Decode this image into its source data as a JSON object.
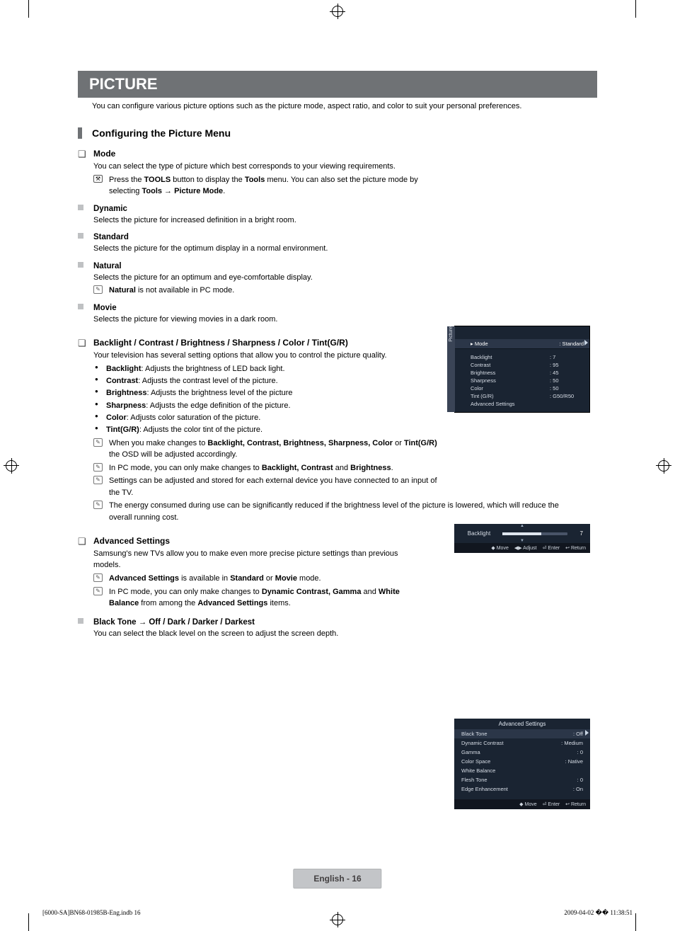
{
  "header": {
    "title": "PICTURE"
  },
  "intro": "You can configure various picture options such as the picture mode, aspect ratio, and color to suit your personal preferences.",
  "section_title": "Configuring the Picture Menu",
  "mode": {
    "title": "Mode",
    "desc": "You can select the type of picture which best corresponds to your viewing requirements.",
    "tools_pre": "Press the ",
    "tools_b1": "TOOLS",
    "tools_mid": " button to display the ",
    "tools_b2": "Tools",
    "tools_mid2": " menu. You can also set the picture mode by selecting ",
    "tools_b3": "Tools → Picture Mode",
    "tools_end": ".",
    "dynamic": {
      "title": "Dynamic",
      "desc": "Selects the picture for increased definition in a bright room."
    },
    "standard": {
      "title": "Standard",
      "desc": "Selects the picture for the optimum display in a normal environment."
    },
    "natural": {
      "title": "Natural",
      "desc": "Selects the picture for an optimum and eye-comfortable display.",
      "note_b": "Natural",
      "note_rest": " is not available in PC mode."
    },
    "movie": {
      "title": "Movie",
      "desc": "Selects the picture for viewing movies in a dark room."
    }
  },
  "settings": {
    "title": "Backlight / Contrast / Brightness / Sharpness / Color / Tint(G/R)",
    "desc": "Your television has several setting options that allow you to control the picture quality.",
    "items": {
      "backlight_b": "Backlight",
      "backlight_t": ": Adjusts the brightness of LED back light.",
      "contrast_b": "Contrast",
      "contrast_t": ": Adjusts the contrast level of the picture.",
      "brightness_b": "Brightness",
      "brightness_t": ": Adjusts the brightness level of the picture",
      "sharpness_b": "Sharpness",
      "sharpness_t": ": Adjusts the edge definition of the picture.",
      "color_b": "Color",
      "color_t": ": Adjusts color saturation of the picture.",
      "tint_b": "Tint(G/R)",
      "tint_t": ": Adjusts the color tint of the picture."
    },
    "note1_pre": "When you make changes to ",
    "note1_b1": "Backlight, Contrast, Brightness, Sharpness, Color",
    "note1_mid": " or ",
    "note1_b2": "Tint(G/R)",
    "note1_end": " the OSD will be adjusted accordingly.",
    "note2_pre": "In PC mode, you can only make changes to ",
    "note2_b": "Backlight, Contrast",
    "note2_mid": " and ",
    "note2_b2": "Brightness",
    "note2_end": ".",
    "note3": "Settings can be adjusted and stored for each external device you have connected to an input of the TV.",
    "note4": "The energy consumed during use can be significantly reduced if the brightness level of the picture is lowered, which will reduce the overall running cost."
  },
  "advanced": {
    "title": "Advanced Settings",
    "desc": "Samsung's new TVs allow you to make even more precise picture settings than previous models.",
    "note1_b": "Advanced Settings",
    "note1_mid": " is available in ",
    "note1_b2": "Standard",
    "note1_mid2": " or ",
    "note1_b3": "Movie",
    "note1_end": " mode.",
    "note2_pre": "In PC mode, you can only make changes to ",
    "note2_b": "Dynamic Contrast, Gamma",
    "note2_mid": " and ",
    "note2_b2": "White Balance",
    "note2_mid2": " from among the ",
    "note2_b3": "Advanced Settings",
    "note2_end": " items.",
    "black": {
      "title": "Black Tone → Off / Dark / Darker / Darkest",
      "desc": "You can select the black level on the screen to adjust the screen depth."
    }
  },
  "osd_picture": {
    "tab": "Picture",
    "mode_lbl": "Mode",
    "mode_val": "Standard",
    "rows": [
      {
        "l": "Backlight",
        "v": "7"
      },
      {
        "l": "Contrast",
        "v": "95"
      },
      {
        "l": "Brightness",
        "v": "45"
      },
      {
        "l": "Sharpness",
        "v": "50"
      },
      {
        "l": "Color",
        "v": "50"
      },
      {
        "l": "Tint (G/R)",
        "v": "G50/R50"
      },
      {
        "l": "Advanced Settings",
        "v": ""
      }
    ]
  },
  "osd_backlight": {
    "label": "Backlight",
    "value": "7",
    "foot": [
      "◆ Move",
      "◀▶ Adjust",
      "⏎ Enter",
      "↩ Return"
    ]
  },
  "osd_adv": {
    "title": "Advanced Settings",
    "rows": [
      {
        "l": "Black Tone",
        "v": "Off",
        "hl": true
      },
      {
        "l": "Dynamic Contrast",
        "v": "Medium"
      },
      {
        "l": "Gamma",
        "v": "0"
      },
      {
        "l": "Color Space",
        "v": "Native"
      },
      {
        "l": "White Balance",
        "v": ""
      },
      {
        "l": "Flesh Tone",
        "v": "0"
      },
      {
        "l": "Edge Enhancement",
        "v": "On"
      }
    ],
    "foot": [
      "◆ Move",
      "⏎ Enter",
      "↩ Return"
    ]
  },
  "footer": {
    "center": "English - 16",
    "left": "[6000-SA]BN68-01985B-Eng.indb   16",
    "right": "2009-04-02   �� 11:38:51"
  }
}
